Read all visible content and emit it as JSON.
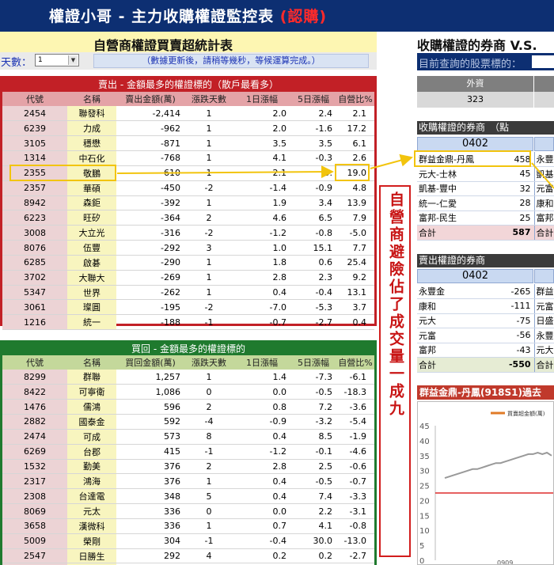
{
  "window": {
    "title_main": "權證小哥 - 主力收購權證監控表",
    "title_tag": "(認購)"
  },
  "left_panel": {
    "title": "自營商權證買賣超統計表",
    "days_label": "天數：",
    "days_value": "1",
    "notice": "（數據更新後，請稍等幾秒，等候運算完成。）"
  },
  "sell_table": {
    "title": "賣出 - 金額最多的權證標的（散戶最看多）",
    "headers": [
      "代號",
      "名稱",
      "賣出金額(萬)",
      "漲跌天數",
      "1日漲幅",
      "5日漲幅",
      "自營比%"
    ],
    "rows": [
      [
        "2454",
        "聯發科",
        "-2,414",
        "1",
        "2.0",
        "2.4",
        "2.1"
      ],
      [
        "6239",
        "力成",
        "-962",
        "1",
        "2.0",
        "-1.6",
        "17.2"
      ],
      [
        "3105",
        "穩懋",
        "-871",
        "1",
        "3.5",
        "3.5",
        "6.1"
      ],
      [
        "1314",
        "中石化",
        "-768",
        "1",
        "4.1",
        "-0.3",
        "2.6"
      ],
      [
        "2355",
        "敬鵬",
        "-610",
        "1",
        "2.1",
        "5.",
        "19.0"
      ],
      [
        "2357",
        "華碩",
        "-450",
        "-2",
        "-1.4",
        "-0.9",
        "4.8"
      ],
      [
        "8942",
        "森鉅",
        "-392",
        "1",
        "1.9",
        "3.4",
        "13.9"
      ],
      [
        "6223",
        "旺矽",
        "-364",
        "2",
        "4.6",
        "6.5",
        "7.9"
      ],
      [
        "3008",
        "大立光",
        "-316",
        "-2",
        "-1.2",
        "-0.8",
        "-5.0"
      ],
      [
        "8076",
        "伍豐",
        "-292",
        "3",
        "1.0",
        "15.1",
        "7.7"
      ],
      [
        "6285",
        "啟碁",
        "-290",
        "1",
        "1.8",
        "0.6",
        "25.4"
      ],
      [
        "3702",
        "大聯大",
        "-269",
        "1",
        "2.8",
        "2.3",
        "9.2"
      ],
      [
        "5347",
        "世界",
        "-262",
        "1",
        "0.4",
        "-0.4",
        "13.1"
      ],
      [
        "3061",
        "璨圓",
        "-195",
        "-2",
        "-7.0",
        "-5.3",
        "3.7"
      ],
      [
        "1216",
        "統一",
        "-188",
        "-1",
        "-0.7",
        "-2.7",
        "0.4"
      ]
    ]
  },
  "buy_table": {
    "title": "買回 - 金額最多的權證標的",
    "headers": [
      "代號",
      "名稱",
      "買回金額(萬)",
      "漲跌天數",
      "1日漲幅",
      "5日漲幅",
      "自營比%"
    ],
    "rows": [
      [
        "8299",
        "群聯",
        "1,257",
        "1",
        "1.4",
        "-7.3",
        "-6.1"
      ],
      [
        "8422",
        "可寧衛",
        "1,086",
        "0",
        "0.0",
        "-0.5",
        "-18.3"
      ],
      [
        "1476",
        "儒鴻",
        "596",
        "2",
        "0.8",
        "7.2",
        "-3.6"
      ],
      [
        "2882",
        "國泰金",
        "592",
        "-4",
        "-0.9",
        "-3.2",
        "-5.4"
      ],
      [
        "2474",
        "可成",
        "573",
        "8",
        "0.4",
        "8.5",
        "-1.9"
      ],
      [
        "6269",
        "台郡",
        "415",
        "-1",
        "-1.2",
        "-0.1",
        "-4.6"
      ],
      [
        "1532",
        "勤美",
        "376",
        "2",
        "2.8",
        "2.5",
        "-0.6"
      ],
      [
        "2317",
        "鴻海",
        "376",
        "1",
        "0.4",
        "-0.5",
        "-0.7"
      ],
      [
        "2308",
        "台達電",
        "348",
        "5",
        "0.4",
        "7.4",
        "-3.3"
      ],
      [
        "8069",
        "元太",
        "336",
        "0",
        "0.0",
        "2.2",
        "-3.1"
      ],
      [
        "3658",
        "漢微科",
        "336",
        "1",
        "0.7",
        "4.1",
        "-0.8"
      ],
      [
        "5009",
        "榮剛",
        "304",
        "-1",
        "-0.4",
        "30.0",
        "-13.0"
      ],
      [
        "2547",
        "日勝生",
        "292",
        "4",
        "0.2",
        "0.2",
        "-2.7"
      ],
      [
        "2913",
        "農林",
        "277",
        "-1",
        "-1.1",
        "3.2",
        "-5.6"
      ]
    ]
  },
  "annotation": {
    "text": "自營商避險佔了成交量一成九"
  },
  "right_panel": {
    "title": "收購權證的券商 V.S.",
    "stock_label": "目前查詢的股票標的：",
    "foreign_header": "外資",
    "foreign_value": "323",
    "buy_brokers": {
      "title": "收購權證的券商　（點",
      "code": "0402",
      "rows": [
        [
          "群益金鼎-丹鳳",
          "458",
          "永豐"
        ],
        [
          "元大-士林",
          "45",
          "凱基"
        ],
        [
          "凱基-豐中",
          "32",
          "元富"
        ],
        [
          "統一-仁愛",
          "28",
          "康和"
        ],
        [
          "富邦-民生",
          "25",
          "富邦"
        ]
      ],
      "total_label": "合計",
      "total_value": "587",
      "total_label2": "合計"
    },
    "sell_brokers": {
      "title": "賣出權證的券商",
      "code": "0402",
      "rows": [
        [
          "永豐金",
          "-265",
          "群益"
        ],
        [
          "康和",
          "-111",
          "元富"
        ],
        [
          "元大",
          "-75",
          "日盛"
        ],
        [
          "元富",
          "-56",
          "永豐"
        ],
        [
          "富邦",
          "-43",
          "元大"
        ]
      ],
      "total_label": "合計",
      "total_value": "-550",
      "total_label2": "合計"
    }
  },
  "chart_data": {
    "type": "line",
    "title": "群益金鼎-丹鳳(918S1)過去",
    "legend": [
      "買賣超金額(萬)"
    ],
    "ylim": [
      0,
      45
    ],
    "yticks": [
      0,
      5,
      10,
      15,
      20,
      25,
      30,
      35,
      40,
      45
    ],
    "xtick_labels": [
      "0909"
    ],
    "series": [
      {
        "name": "買賣超金額(萬)",
        "values": [
          27.5,
          28,
          28.5,
          29,
          29.5,
          30,
          30.5,
          30.5,
          31,
          31.5,
          32,
          32.5,
          32.5,
          33,
          33.5,
          34,
          34.5,
          35,
          35.5,
          35.5,
          36,
          35.5,
          36,
          35
        ]
      }
    ],
    "reference_line": 22.5,
    "colors": {
      "line": "#999999",
      "legend": "#e07b27",
      "reference": "#d60000"
    }
  }
}
